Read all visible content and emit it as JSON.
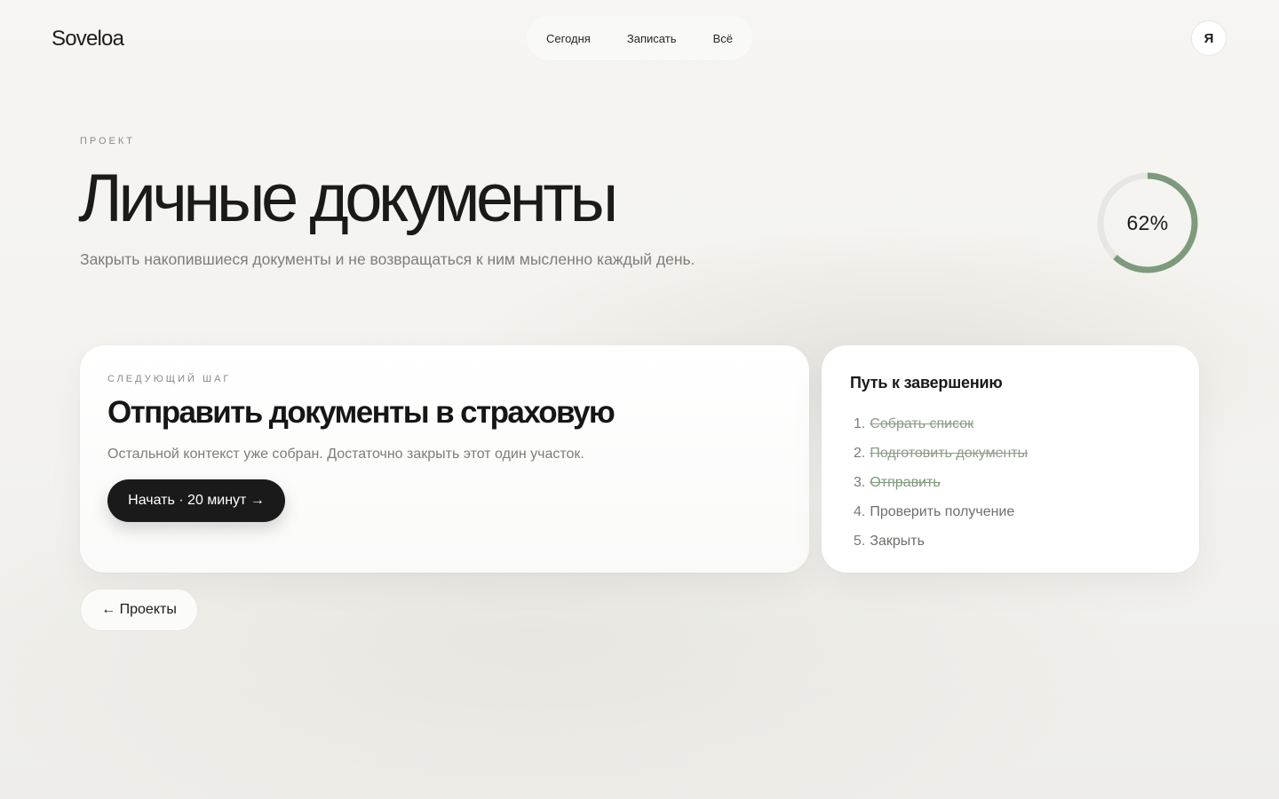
{
  "app": {
    "logo": "Soveloa"
  },
  "nav": {
    "items": [
      {
        "label": "Сегодня"
      },
      {
        "label": "Записать"
      },
      {
        "label": "Всё"
      }
    ]
  },
  "user": {
    "avatar_initial": "Я"
  },
  "project": {
    "eyebrow": "ПРОЕКТ",
    "title": "Личные документы",
    "description": "Закрыть накопившиеся документы и не возвращаться к ним мысленно каждый день.",
    "progress_percent": 62,
    "progress_label": "62%"
  },
  "next_step": {
    "eyebrow": "СЛЕДУЮЩИЙ ШАГ",
    "title": "Отправить документы в страховую",
    "description": "Остальной контекст уже собран. Достаточно закрыть этот один участок.",
    "button_label": "Начать · 20 минут →"
  },
  "path": {
    "title": "Путь к завершению",
    "steps": [
      {
        "num": "1.",
        "label": "Собрать список",
        "state": "done"
      },
      {
        "num": "2.",
        "label": "Подготовить документы",
        "state": "done"
      },
      {
        "num": "3.",
        "label": "Отправить",
        "state": "active"
      },
      {
        "num": "4.",
        "label": "Проверить получение",
        "state": "todo"
      },
      {
        "num": "5.",
        "label": "Закрыть",
        "state": "todo"
      }
    ]
  },
  "back": {
    "label": "← Проекты"
  },
  "colors": {
    "accent_green": "#7e9a7c",
    "ring_track": "#e6e6e2",
    "button_dark": "#1a1a1a",
    "background": "#f5f4f0"
  }
}
